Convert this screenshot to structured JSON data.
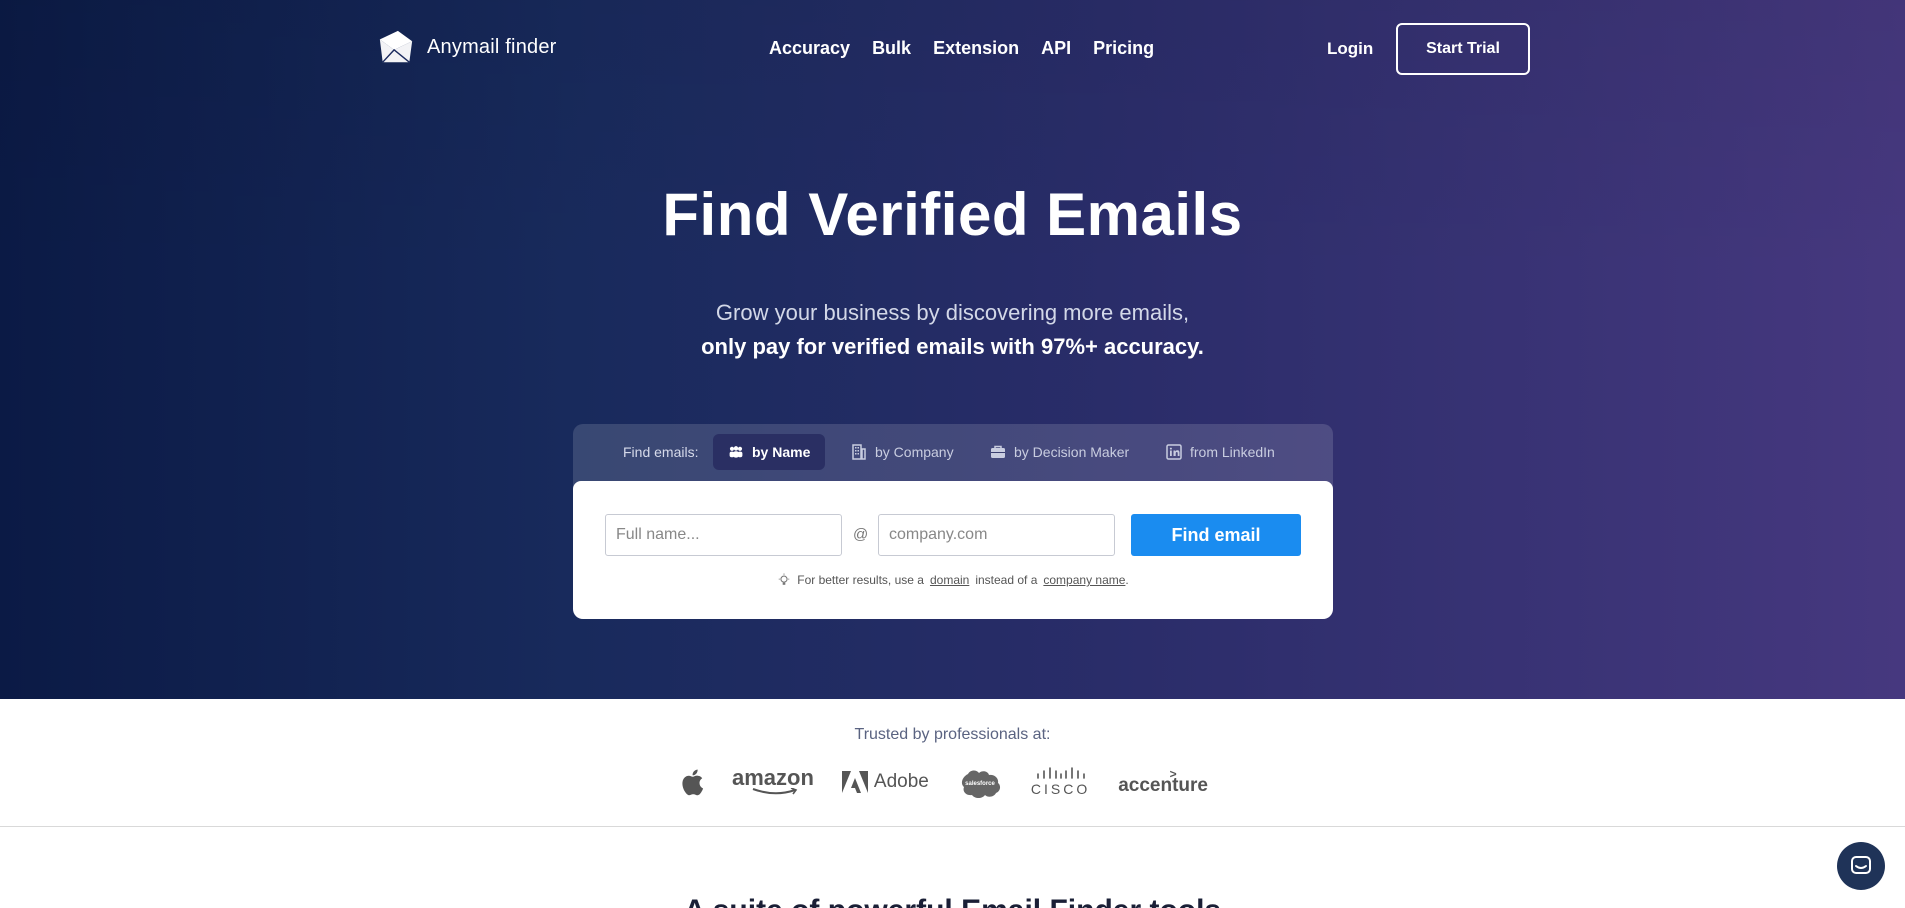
{
  "brand": {
    "name": "Anymail finder"
  },
  "nav": {
    "items": [
      "Accuracy",
      "Bulk",
      "Extension",
      "API",
      "Pricing"
    ],
    "login": "Login",
    "start_trial": "Start Trial"
  },
  "hero": {
    "title": "Find Verified Emails",
    "subtitle_line1": "Grow your business by discovering more emails,",
    "subtitle_line2": "only pay for verified emails with 97%+ accuracy."
  },
  "search": {
    "tabs_label": "Find emails:",
    "tabs": [
      {
        "label": "by Name",
        "icon": "people-icon",
        "active": true
      },
      {
        "label": "by Company",
        "icon": "building-icon",
        "active": false
      },
      {
        "label": "by Decision Maker",
        "icon": "briefcase-icon",
        "active": false
      },
      {
        "label": "from LinkedIn",
        "icon": "linkedin-icon",
        "active": false
      }
    ],
    "name_placeholder": "Full name...",
    "at_symbol": "@",
    "domain_placeholder": "company.com",
    "button_label": "Find email",
    "hint_prefix": "For better results, use a",
    "hint_link1": "domain",
    "hint_middle": "instead of a",
    "hint_link2": "company name",
    "hint_suffix": "."
  },
  "trusted": {
    "label": "Trusted by professionals at:",
    "logos": [
      "apple",
      "amazon",
      "Adobe",
      "salesforce",
      "CISCO",
      "accenture"
    ]
  },
  "next_section": {
    "title": "A suite of powerful Email Finder tools"
  },
  "colors": {
    "accent": "#1a8cf0",
    "hero_start": "#0b1a45",
    "hero_end": "#46387f"
  }
}
